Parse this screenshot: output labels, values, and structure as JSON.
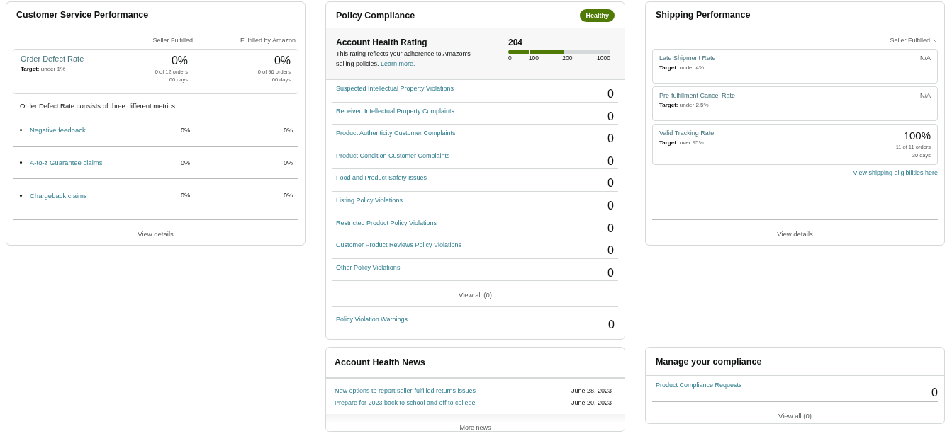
{
  "customer_service_performance": {
    "title": "Customer Service Performance",
    "columns": [
      "Seller Fulfilled",
      "Fulfilled by Amazon"
    ],
    "order_defect_rate": {
      "label": "Order Defect Rate",
      "target": "**Target:** under 1%",
      "values": [
        {
          "value": "0%",
          "orders": "0 of 12 orders",
          "period": "60 days"
        },
        {
          "value": "0%",
          "orders": "0 of 96 orders",
          "period": "60 days"
        }
      ]
    },
    "description": "Order Defect Rate consists of three different metrics:",
    "metrics": [
      {
        "label": "Negative feedback",
        "values": [
          "0%",
          "0%"
        ]
      },
      {
        "label": "A-to-z Guarantee claims",
        "values": [
          "0%",
          "0%"
        ]
      },
      {
        "label": "Chargeback claims",
        "values": [
          "0%",
          "0%"
        ]
      }
    ],
    "footer_link": "View details"
  },
  "policy_compliance": {
    "title": "Policy Compliance",
    "status": "Healthy",
    "rating": {
      "title": "Account Health Rating",
      "description": "This rating reflects your adherence to Amazon's selling policies.",
      "link": "Learn more.",
      "score": "204",
      "level": 0.54,
      "ticks": [
        "0",
        "100",
        "200",
        "1000"
      ]
    },
    "violations": [
      {
        "label": "Suspected Intellectual Property Violations",
        "count": "0"
      },
      {
        "label": "Received Intellectual Property Complaints",
        "count": "0"
      },
      {
        "label": "Product Authenticity Customer Complaints",
        "count": "0"
      },
      {
        "label": "Product Condition Customer Complaints",
        "count": "0"
      },
      {
        "label": "Food and Product Safety Issues",
        "count": "0"
      },
      {
        "label": "Listing Policy Violations",
        "count": "0"
      },
      {
        "label": "Restricted Product Policy Violations",
        "count": "0"
      },
      {
        "label": "Customer Product Reviews Policy Violations",
        "count": "0"
      },
      {
        "label": "Other Policy Violations",
        "count": "0"
      }
    ],
    "view_all": "View all (0)",
    "warnings": {
      "label": "Policy Violation Warnings",
      "count": "0"
    }
  },
  "account_health_news": {
    "title": "Account Health News",
    "items": [
      {
        "title": "New options to report seller-fulfilled returns issues",
        "date": "June 28, 2023"
      },
      {
        "title": "Prepare for 2023 back to school and off to college",
        "date": "June 20, 2023"
      }
    ],
    "more": "More news"
  },
  "shipping_performance": {
    "title": "Shipping Performance",
    "filter": "Seller Fulfilled",
    "metrics": [
      {
        "kind": "unavailable",
        "label": "Late Shipment Rate",
        "target": "**Target:** under 4%",
        "value": "N/A"
      },
      {
        "kind": "unavailable",
        "label": "Pre-fulfillment Cancel Rate",
        "target": "**Target:** under 2.5%",
        "value": "N/A"
      },
      {
        "kind": "measured",
        "label": "Valid Tracking Rate",
        "target": "**Target:** over 95%",
        "value": "100%",
        "orders": "11 of 11 orders",
        "period": "30 days"
      }
    ],
    "link": "View shipping eligibilities here",
    "footer_link": "View details"
  },
  "manage_compliance": {
    "title": "Manage your compliance",
    "items": [
      {
        "label": "Product Compliance Requests",
        "count": "0"
      }
    ],
    "view_all": "View all (0)"
  }
}
